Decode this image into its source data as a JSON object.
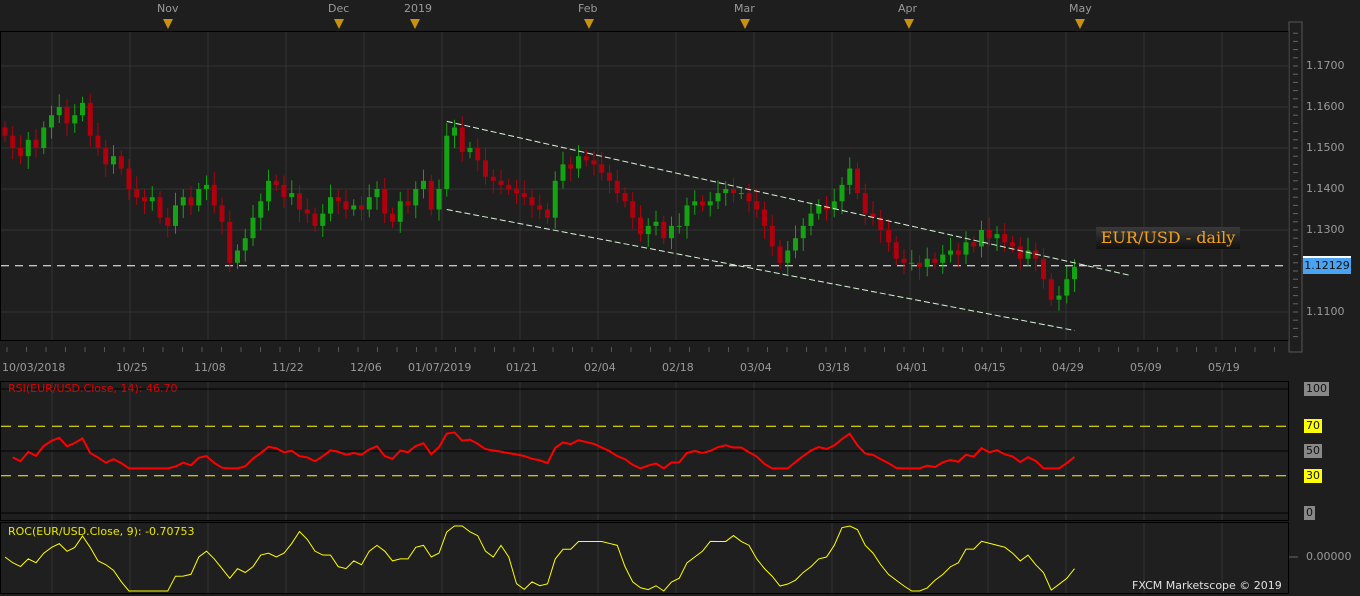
{
  "chart_data": {
    "type": "candlestick",
    "title": "EUR/USD - daily",
    "instrument": "EUR/USD",
    "current_price": "1.12129",
    "current_price_value": 1.12129,
    "month_markers": [
      "Nov",
      "Dec",
      "2019",
      "Feb",
      "Mar",
      "Apr",
      "May"
    ],
    "date_ticks": [
      "10/03/2018",
      "10/25",
      "11/08",
      "11/22",
      "12/06",
      "01/07/2019",
      "01/21",
      "02/04",
      "02/18",
      "03/04",
      "03/18",
      "04/01",
      "04/15",
      "04/29",
      "05/09",
      "05/19"
    ],
    "price_ticks": [
      "1.1700",
      "1.1600",
      "1.1500",
      "1.1400",
      "1.1300",
      "1.1100"
    ],
    "ylim": [
      1.1035,
      1.1795
    ],
    "closes": [
      1.153,
      1.15,
      1.148,
      1.152,
      1.15,
      1.155,
      1.158,
      1.16,
      1.156,
      1.158,
      1.161,
      1.153,
      1.15,
      1.146,
      1.148,
      1.145,
      1.14,
      1.138,
      1.137,
      1.138,
      1.133,
      1.131,
      1.136,
      1.138,
      1.136,
      1.14,
      1.141,
      1.136,
      1.132,
      1.122,
      1.125,
      1.128,
      1.133,
      1.137,
      1.142,
      1.141,
      1.138,
      1.139,
      1.135,
      1.134,
      1.131,
      1.134,
      1.138,
      1.137,
      1.135,
      1.136,
      1.135,
      1.138,
      1.14,
      1.134,
      1.132,
      1.137,
      1.136,
      1.14,
      1.142,
      1.135,
      1.14,
      1.153,
      1.155,
      1.149,
      1.15,
      1.147,
      1.143,
      1.142,
      1.141,
      1.14,
      1.139,
      1.138,
      1.136,
      1.135,
      1.133,
      1.142,
      1.146,
      1.145,
      1.148,
      1.147,
      1.146,
      1.144,
      1.142,
      1.139,
      1.137,
      1.133,
      1.129,
      1.131,
      1.132,
      1.128,
      1.131,
      1.131,
      1.136,
      1.137,
      1.136,
      1.137,
      1.139,
      1.14,
      1.139,
      1.139,
      1.137,
      1.135,
      1.131,
      1.126,
      1.122,
      1.125,
      1.128,
      1.131,
      1.134,
      1.136,
      1.135,
      1.137,
      1.141,
      1.145,
      1.139,
      1.134,
      1.133,
      1.13,
      1.127,
      1.123,
      1.122,
      1.122,
      1.121,
      1.123,
      1.122,
      1.124,
      1.125,
      1.124,
      1.127,
      1.126,
      1.13,
      1.128,
      1.129,
      1.127,
      1.126,
      1.123,
      1.125,
      1.123,
      1.118,
      1.113,
      1.114,
      1.118,
      1.121
    ],
    "channel": {
      "upper": [
        [
          57,
          1.1565
        ],
        [
          145,
          1.119
        ]
      ],
      "lower": [
        [
          57,
          1.135
        ],
        [
          138,
          1.1055
        ]
      ]
    },
    "rsi": {
      "label": "RSI(EUR/USD.Close, 14): 46.70",
      "period": 14,
      "last": 46.7,
      "levels": [
        70,
        30
      ],
      "ticks": [
        "100",
        "70",
        "50",
        "30",
        "0"
      ],
      "ylim": [
        0,
        100
      ]
    },
    "roc": {
      "label": "ROC(EUR/USD.Close, 9): -0.70753",
      "period": 9,
      "last": -0.70753,
      "ticks": [
        "0.00000"
      ]
    }
  },
  "footer": {
    "copyright": "FXCM Marketscope © 2019"
  },
  "colors": {
    "up": "#13a313",
    "down": "#b0000e",
    "rsi": "#ff0000",
    "roc": "#ffff00",
    "level": "#ffff00",
    "price_tag": "#4aa3f0",
    "title": "#f5a21b"
  }
}
